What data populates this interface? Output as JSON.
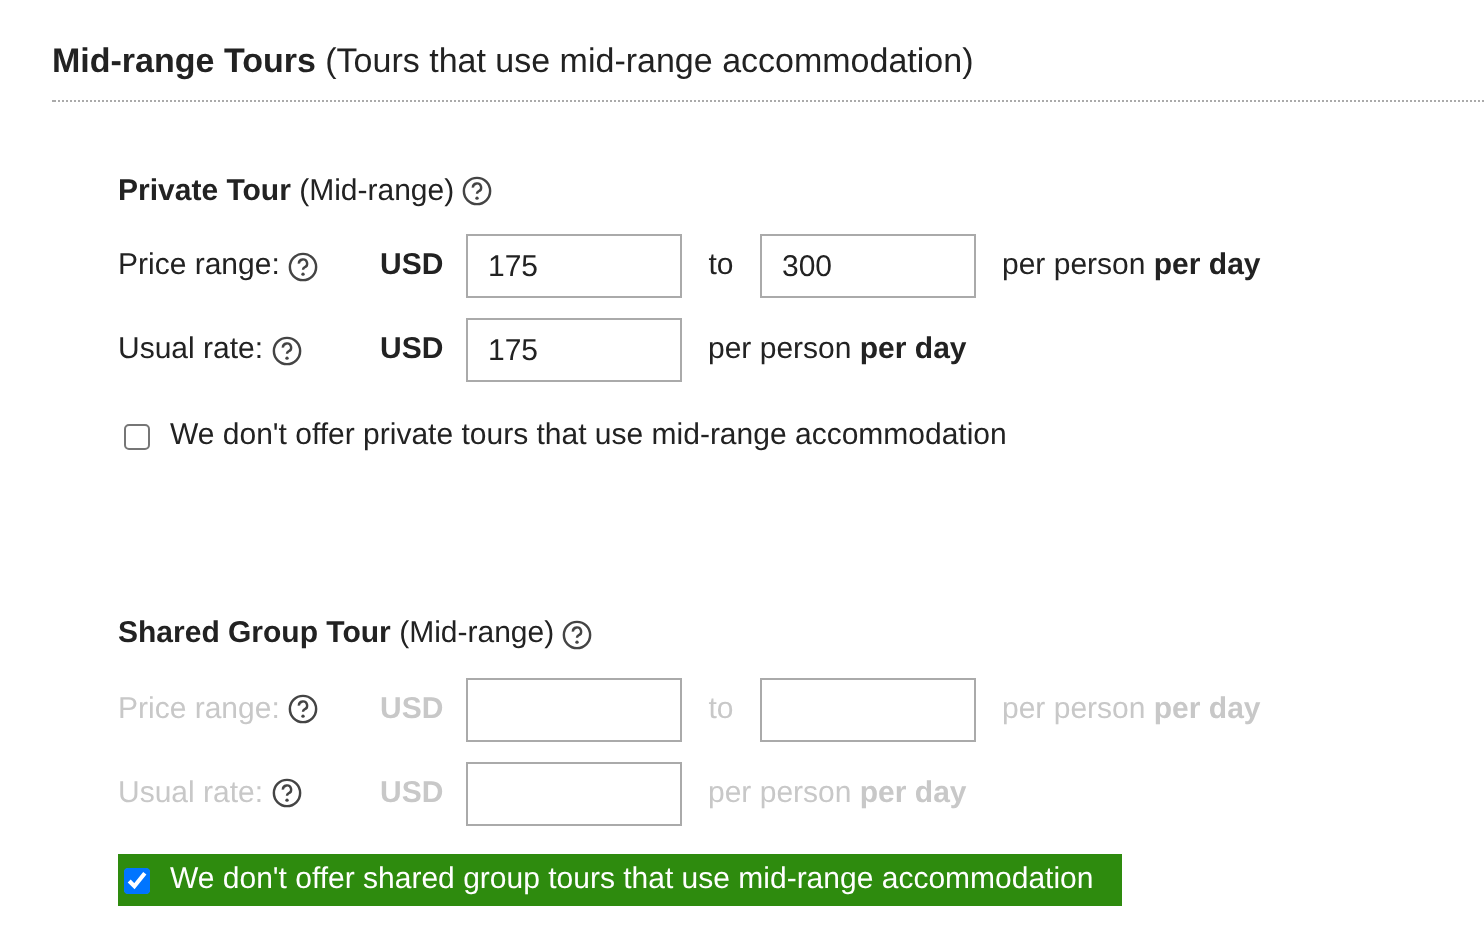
{
  "heading": "**Mid-range Tours** (Tours that use mid-range accommodation)",
  "sections": [
    {
      "title": "**Private Tour** (Mid-range)",
      "rows": [
        {
          "kind": "range",
          "label": "Price range:",
          "disabled": false,
          "currency": "USD",
          "values": [
            "175",
            "300"
          ],
          "between": "to",
          "unit": "per person **per day**"
        },
        {
          "kind": "single",
          "label": "Usual rate:",
          "disabled": false,
          "currency": "USD",
          "values": [
            "175"
          ],
          "unit": "per person **per day**"
        }
      ],
      "opt_out": {
        "label": "We don't offer private tours that use mid-range accommodation",
        "checked": false
      }
    },
    {
      "title": "**Shared Group Tour** (Mid-range)",
      "rows": [
        {
          "kind": "range",
          "label": "Price range:",
          "disabled": true,
          "currency": "USD",
          "between": "to",
          "unit": "per person **per day**"
        },
        {
          "kind": "single",
          "label": "Usual rate:",
          "disabled": true,
          "currency": "USD",
          "unit": "per person **per day**"
        }
      ],
      "opt_out": {
        "label": "We don't offer shared group tours that use mid-range accommodation",
        "checked": true
      }
    }
  ]
}
